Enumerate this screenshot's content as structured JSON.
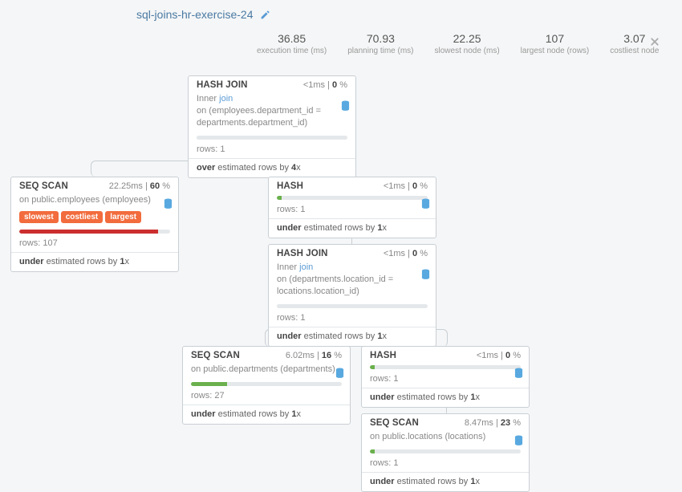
{
  "title": "sql-joins-hr-exercise-24",
  "metrics": [
    {
      "value": "36.85",
      "label": "execution time (ms)"
    },
    {
      "value": "70.93",
      "label": "planning time (ms)"
    },
    {
      "value": "22.25",
      "label": "slowest node (ms)"
    },
    {
      "value": "107",
      "label": "largest node (rows)"
    },
    {
      "value": "3.07",
      "label": "costliest node"
    }
  ],
  "nodes": {
    "hashjoin1": {
      "title": "HASH JOIN",
      "time": "<1ms",
      "pct": "0",
      "sub_pre": "Inner",
      "sub_link": "join",
      "sub_rest": "on (employees.department_id = departments.department_id)",
      "rows": "rows: 1",
      "est_b": "over",
      "est_rest": " estimated rows by ",
      "est_n": "4"
    },
    "seqscan1": {
      "title": "SEQ SCAN",
      "time": "22.25ms",
      "pct": "60",
      "sub": "on public.employees (employees)",
      "tags": [
        "slowest",
        "costliest",
        "largest"
      ],
      "rows": "rows: 107",
      "est_b": "under",
      "est_rest": " estimated rows by ",
      "est_n": "1"
    },
    "hash1": {
      "title": "HASH",
      "time": "<1ms",
      "pct": "0",
      "rows": "rows: 1",
      "est_b": "under",
      "est_rest": " estimated rows by ",
      "est_n": "1"
    },
    "hashjoin2": {
      "title": "HASH JOIN",
      "time": "<1ms",
      "pct": "0",
      "sub_pre": "Inner",
      "sub_link": "join",
      "sub_rest": "on (departments.location_id = locations.location_id)",
      "rows": "rows: 1",
      "est_b": "under",
      "est_rest": " estimated rows by ",
      "est_n": "1"
    },
    "seqscan2": {
      "title": "SEQ SCAN",
      "time": "6.02ms",
      "pct": "16",
      "sub": "on public.departments (departments)",
      "rows": "rows: 27",
      "est_b": "under",
      "est_rest": " estimated rows by ",
      "est_n": "1"
    },
    "hash2": {
      "title": "HASH",
      "time": "<1ms",
      "pct": "0",
      "rows": "rows: 1",
      "est_b": "under",
      "est_rest": " estimated rows by ",
      "est_n": "1"
    },
    "seqscan3": {
      "title": "SEQ SCAN",
      "time": "8.47ms",
      "pct": "23",
      "sub": "on public.locations (locations)",
      "rows": "rows: 1",
      "est_b": "under",
      "est_rest": " estimated rows by ",
      "est_n": "1"
    }
  }
}
